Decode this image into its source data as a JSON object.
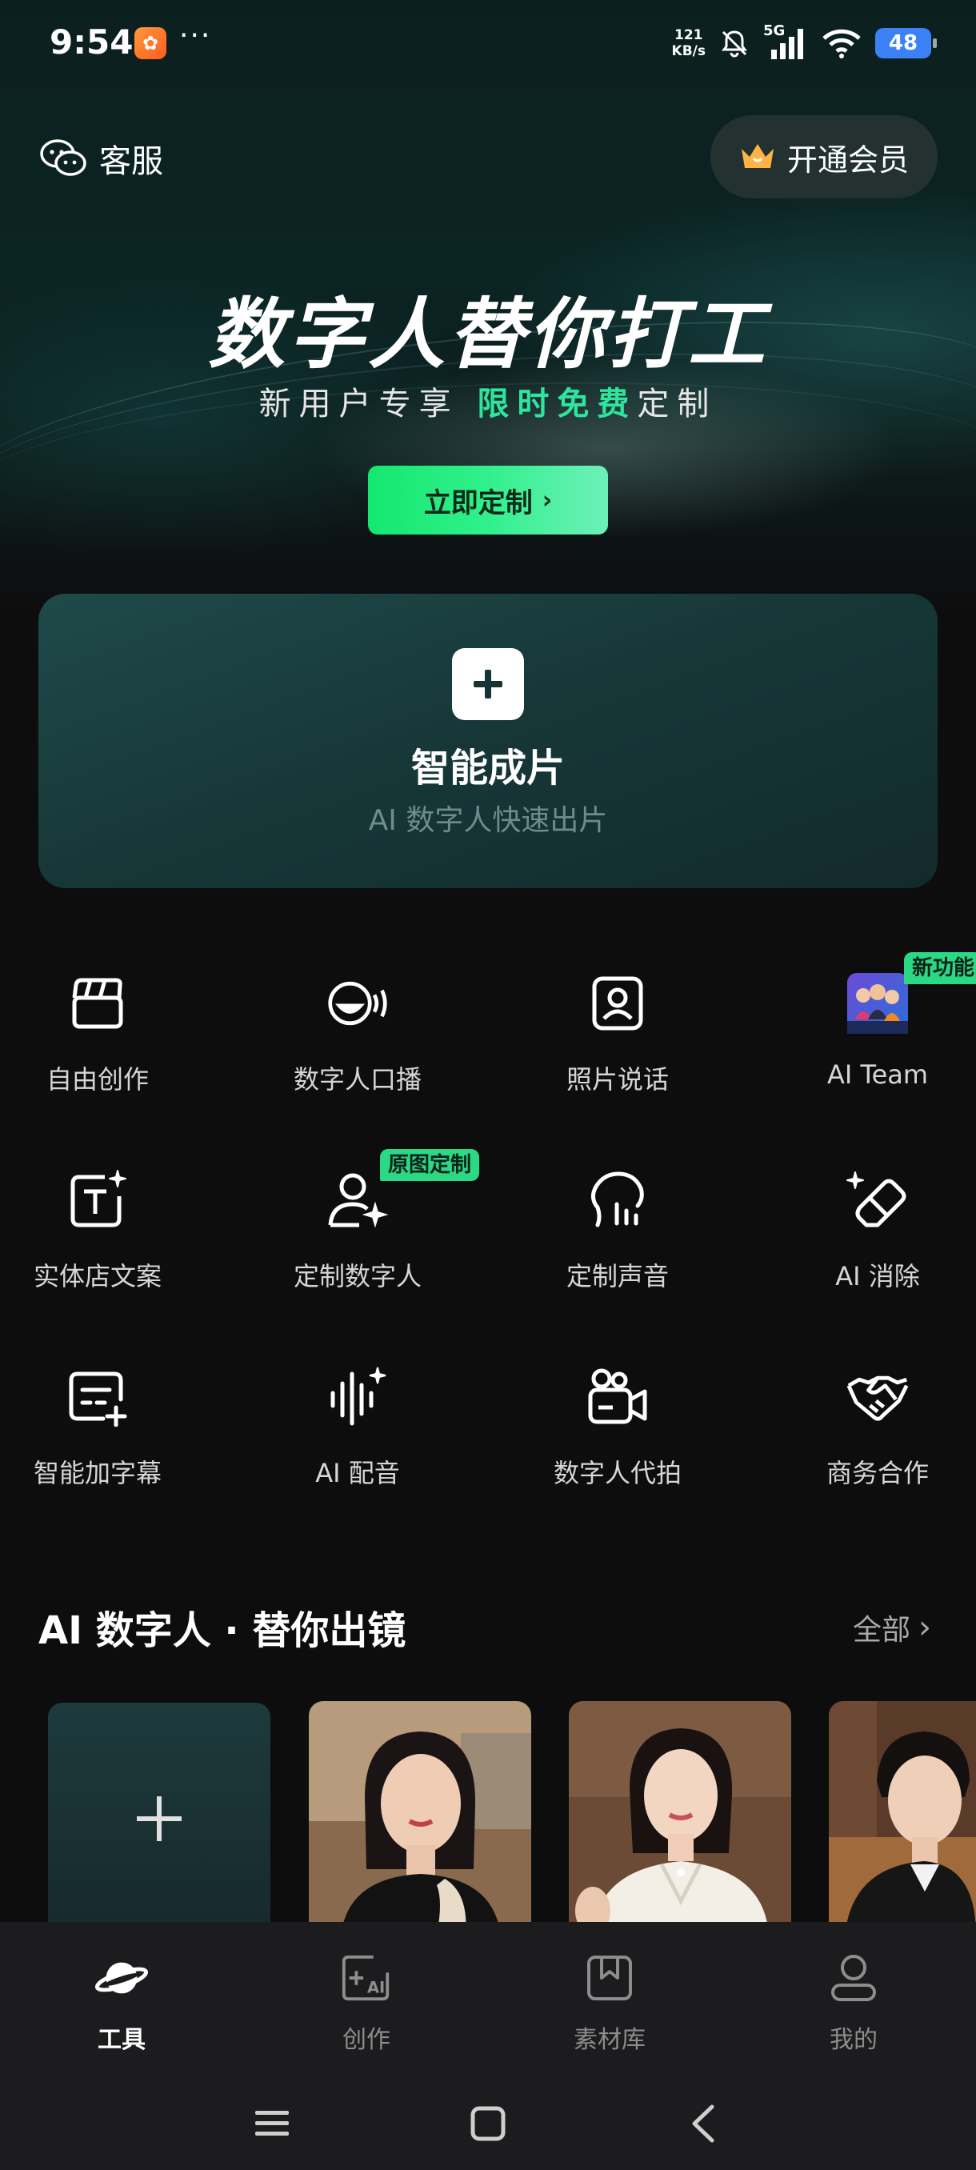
{
  "status_bar": {
    "time": "9:54",
    "more": "···",
    "net_speed_value": "121",
    "net_speed_unit": "KB/s",
    "network": "5G",
    "battery": "48"
  },
  "header": {
    "service_label": "客服",
    "vip_label": "开通会员"
  },
  "hero": {
    "title": "数字人替你打工",
    "subtitle_prefix": "新用户专享",
    "subtitle_highlight": "限时免费",
    "subtitle_suffix": "定制",
    "cta_label": "立即定制"
  },
  "smart_card": {
    "title": "智能成片",
    "subtitle": "AI 数字人快速出片"
  },
  "tools": [
    {
      "label": "自由创作",
      "icon": "clapperboard-icon"
    },
    {
      "label": "数字人口播",
      "icon": "talking-head-icon"
    },
    {
      "label": "照片说话",
      "icon": "photo-portrait-icon"
    },
    {
      "label": "AI Team",
      "icon": "team-avatar-icon",
      "badge": "新功能"
    },
    {
      "label": "实体店文案",
      "icon": "text-sparkle-icon"
    },
    {
      "label": "定制数字人",
      "icon": "person-sparkle-icon",
      "badge": "原图定制"
    },
    {
      "label": "定制声音",
      "icon": "voice-head-icon"
    },
    {
      "label": "AI 消除",
      "icon": "eraser-sparkle-icon"
    },
    {
      "label": "智能加字幕",
      "icon": "subtitle-add-icon"
    },
    {
      "label": "AI 配音",
      "icon": "waveform-sparkle-icon"
    },
    {
      "label": "数字人代拍",
      "icon": "video-camera-icon"
    },
    {
      "label": "商务合作",
      "icon": "handshake-icon"
    }
  ],
  "section": {
    "title": "AI 数字人 · 替你出镜",
    "all_label": "全部"
  },
  "bottom_nav": [
    {
      "label": "工具",
      "icon": "planet-icon",
      "active": true
    },
    {
      "label": "创作",
      "icon": "ai-create-icon",
      "active": false
    },
    {
      "label": "素材库",
      "icon": "bookmark-library-icon",
      "active": false
    },
    {
      "label": "我的",
      "icon": "user-profile-icon",
      "active": false
    }
  ],
  "colors": {
    "accent_green": "#2ee59d",
    "background": "#0d0d0e",
    "card_teal": "#1f4a4a",
    "nav_background": "#1c1c1e"
  }
}
